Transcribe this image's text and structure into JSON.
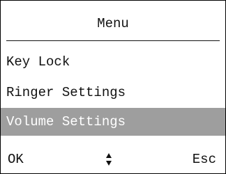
{
  "menu": {
    "title": "Menu",
    "items": [
      {
        "label": "Key Lock",
        "selected": false
      },
      {
        "label": "Ringer Settings",
        "selected": false
      },
      {
        "label": "Volume Settings",
        "selected": true
      }
    ]
  },
  "softkeys": {
    "left_label": "OK",
    "center_icon": "up-down-arrows-icon",
    "right_label": "Esc"
  },
  "colors": {
    "background": "#ffffff",
    "text": "#111111",
    "highlight": "#9e9e9e",
    "highlight_text": "#ffffff"
  }
}
